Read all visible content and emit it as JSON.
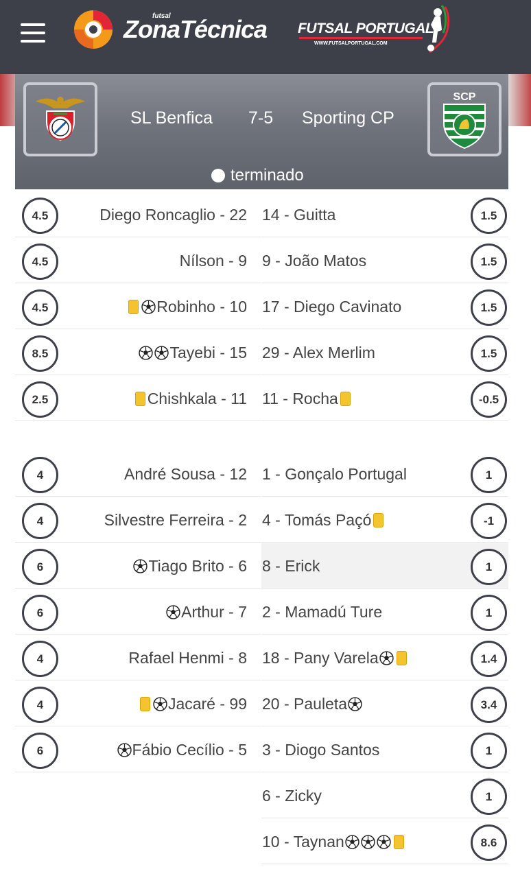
{
  "header": {
    "zt_small": "futsal",
    "zt_title": "ZonaTécnica",
    "fp_title": "FUTSAL PORTUGAL",
    "fp_url": "WWW.FUTSALPORTUGAL.COM"
  },
  "match": {
    "home_team": "SL Benfica",
    "away_team": "Sporting CP",
    "score": "7-5",
    "status": "terminado",
    "away_crest_text": "SCP"
  },
  "starters": [
    {
      "home_rating": "4.5",
      "home_player": "Diego Roncaglio - 22",
      "home_icons": [],
      "away_player": "14 - Guitta",
      "away_icons": [],
      "away_rating": "1.5"
    },
    {
      "home_rating": "4.5",
      "home_player": "Nílson - 9",
      "home_icons": [],
      "away_player": "9 - João Matos",
      "away_icons": [],
      "away_rating": "1.5"
    },
    {
      "home_rating": "4.5",
      "home_player": "Robinho - 10",
      "home_icons": [
        "yellow-card",
        "ball"
      ],
      "away_player": "17 - Diego Cavinato",
      "away_icons": [],
      "away_rating": "1.5"
    },
    {
      "home_rating": "8.5",
      "home_player": "Tayebi - 15",
      "home_icons": [
        "ball",
        "ball"
      ],
      "away_player": "29 - Alex Merlim",
      "away_icons": [],
      "away_rating": "1.5"
    },
    {
      "home_rating": "2.5",
      "home_player": "Chishkala - 11",
      "home_icons": [
        "yellow-card"
      ],
      "away_player": "11 - Rocha",
      "away_icons": [
        "yellow-card"
      ],
      "away_rating": "-0.5"
    }
  ],
  "subs": [
    {
      "home_rating": "4",
      "home_player": "André Sousa - 12",
      "home_icons": [],
      "away_player": "1 - Gonçalo Portugal",
      "away_icons": [],
      "away_rating": "1"
    },
    {
      "home_rating": "4",
      "home_player": "Silvestre Ferreira - 2",
      "home_icons": [],
      "away_player": "4 - Tomás Paçó",
      "away_icons": [
        "yellow-card"
      ],
      "away_rating": "-1"
    },
    {
      "home_rating": "6",
      "home_player": "Tiago Brito - 6",
      "home_icons": [
        "ball"
      ],
      "away_player": "8 - Erick",
      "away_icons": [],
      "away_rating": "1",
      "away_highlight": true
    },
    {
      "home_rating": "6",
      "home_player": "Arthur - 7",
      "home_icons": [
        "ball"
      ],
      "away_player": "2 - Mamadú Ture",
      "away_icons": [],
      "away_rating": "1"
    },
    {
      "home_rating": "4",
      "home_player": "Rafael Henmi - 8",
      "home_icons": [],
      "away_player": "18 - Pany Varela",
      "away_icons": [
        "ball",
        "yellow-card"
      ],
      "away_rating": "1.4"
    },
    {
      "home_rating": "4",
      "home_player": "Jacaré - 99",
      "home_icons": [
        "yellow-card",
        "ball"
      ],
      "away_player": "20 - Pauleta",
      "away_icons": [
        "ball"
      ],
      "away_rating": "3.4"
    },
    {
      "home_rating": "6",
      "home_player": "Fábio Cecílio - 5",
      "home_icons": [
        "ball"
      ],
      "away_player": "3 - Diogo Santos",
      "away_icons": [],
      "away_rating": "1"
    },
    {
      "home_rating": null,
      "home_player": null,
      "home_icons": [],
      "away_player": "6 - Zicky",
      "away_icons": [],
      "away_rating": "1"
    },
    {
      "home_rating": null,
      "home_player": null,
      "home_icons": [],
      "away_player": "10 - Taynan",
      "away_icons": [
        "ball",
        "ball",
        "ball",
        "yellow-card"
      ],
      "away_rating": "8.6"
    }
  ],
  "colors": {
    "header_bg": "#3d4049",
    "badge_border": "#3d4049",
    "yellow_card": "#f4c430",
    "brand_red": "#e32636",
    "brand_orange": "#f39a1b"
  }
}
